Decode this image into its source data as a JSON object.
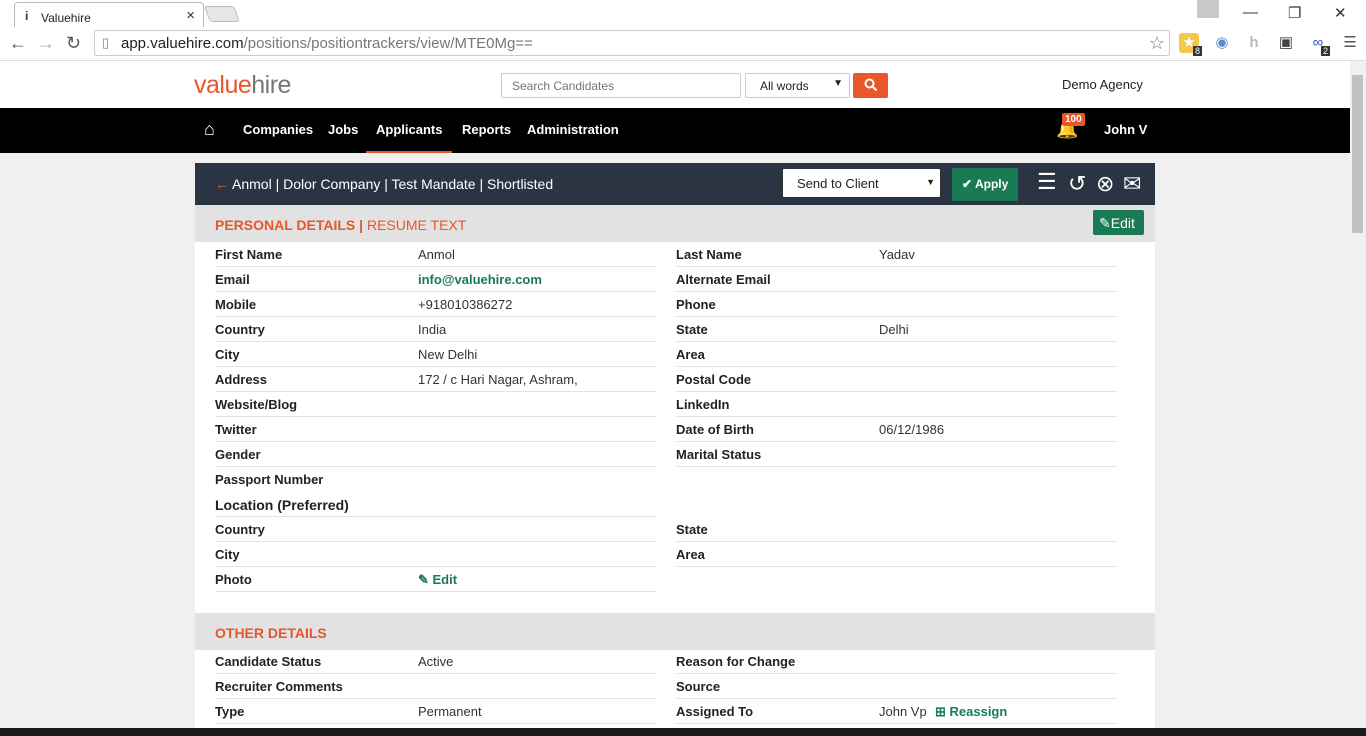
{
  "browser": {
    "tab_title": "Valuehire",
    "url_host": "app.valuehire.com",
    "url_path": "/positions/positiontrackers/view/MTE0Mg==",
    "ext_badge_1": "8",
    "ext_badge_2": "2"
  },
  "header": {
    "logo_value": "value",
    "logo_hire": "hire",
    "search_placeholder": "Search Candidates",
    "words_option": "All words",
    "agency": "Demo Agency"
  },
  "nav": {
    "items": [
      "Companies",
      "Jobs",
      "Applicants",
      "Reports",
      "Administration"
    ],
    "active": "Applicants",
    "notif_count": "100",
    "user": "John V"
  },
  "card": {
    "breadcrumb": "Anmol | Dolor Company | Test Mandate | Shortlisted",
    "action_select": "Send to Client",
    "apply_label": "Apply",
    "personal_title": "PERSONAL DETAILS",
    "resume_tab": "RESUME TEXT",
    "edit_label": "Edit",
    "personal_left": [
      {
        "label": "First Name",
        "value": "Anmol"
      },
      {
        "label": "Email",
        "value": "info@valuehire.com"
      },
      {
        "label": "Mobile",
        "value": "+918010386272"
      },
      {
        "label": "Country",
        "value": "India"
      },
      {
        "label": "City",
        "value": "New Delhi"
      },
      {
        "label": "Address",
        "value": "172 / c Hari Nagar, Ashram,"
      },
      {
        "label": "Website/Blog",
        "value": ""
      },
      {
        "label": "Twitter",
        "value": ""
      },
      {
        "label": "Gender",
        "value": ""
      },
      {
        "label": "Passport Number",
        "value": ""
      }
    ],
    "personal_right": [
      {
        "label": "Last Name",
        "value": "Yadav"
      },
      {
        "label": "Alternate Email",
        "value": ""
      },
      {
        "label": "Phone",
        "value": ""
      },
      {
        "label": "State",
        "value": "Delhi"
      },
      {
        "label": "Area",
        "value": ""
      },
      {
        "label": "Postal Code",
        "value": ""
      },
      {
        "label": "LinkedIn",
        "value": ""
      },
      {
        "label": "Date of Birth",
        "value": "06/12/1986"
      },
      {
        "label": "Marital Status",
        "value": ""
      }
    ],
    "location_title": "Location (Preferred)",
    "location_left": [
      {
        "label": "Country",
        "value": ""
      },
      {
        "label": "City",
        "value": ""
      }
    ],
    "location_right": [
      {
        "label": "State",
        "value": ""
      },
      {
        "label": "Area",
        "value": ""
      }
    ],
    "photo_label": "Photo",
    "photo_edit": "Edit",
    "other_title": "OTHER DETAILS",
    "other_left": [
      {
        "label": "Candidate Status",
        "value": "Active"
      },
      {
        "label": "Recruiter Comments",
        "value": ""
      },
      {
        "label": "Type",
        "value": "Permanent"
      }
    ],
    "other_right": [
      {
        "label": "Reason for Change",
        "value": ""
      },
      {
        "label": "Source",
        "value": ""
      },
      {
        "label": "Assigned To",
        "value": "John Vp"
      }
    ],
    "reassign_label": "Reassign"
  }
}
